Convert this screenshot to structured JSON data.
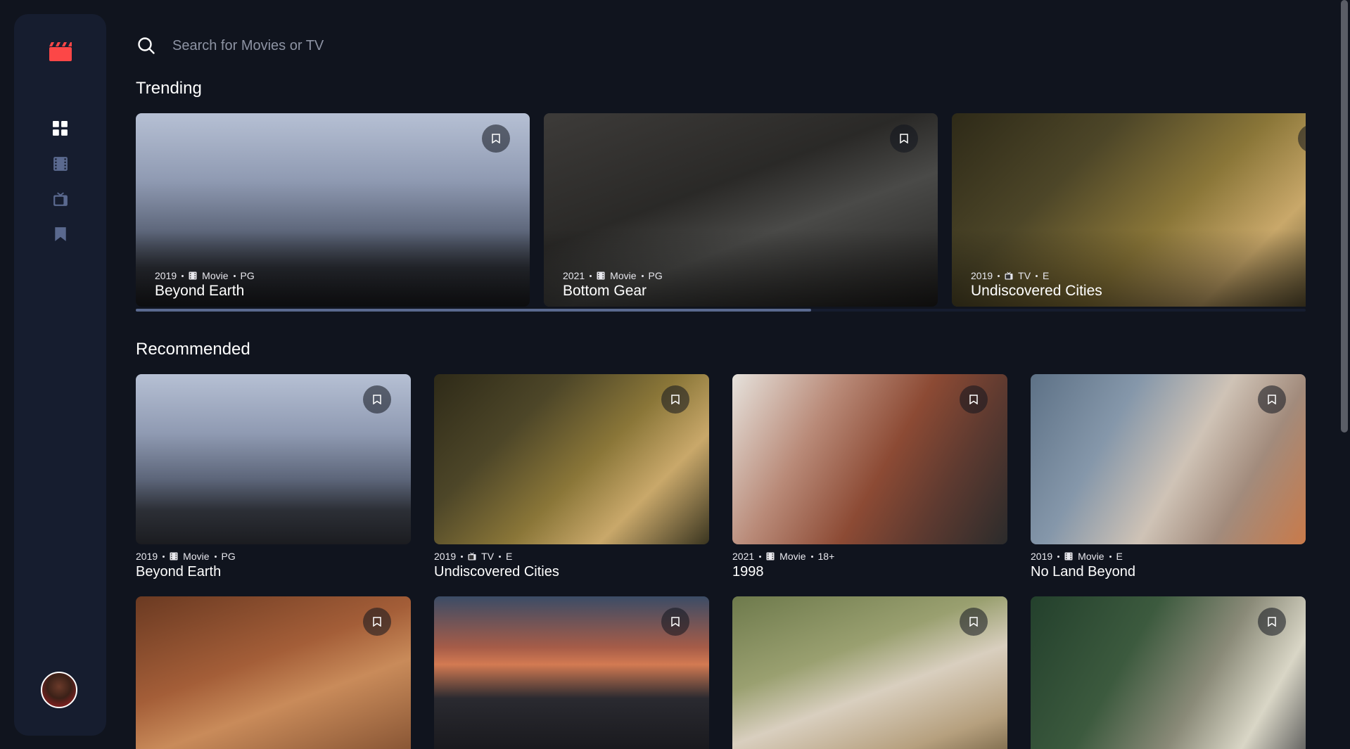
{
  "search": {
    "placeholder": "Search for Movies or TV"
  },
  "sections": {
    "trending_title": "Trending",
    "recommended_title": "Recommended"
  },
  "trending_progress": 0.577,
  "trending": [
    {
      "year": "2019",
      "category": "Movie",
      "rating": "PG",
      "title": "Beyond Earth",
      "image": "rocky-coast"
    },
    {
      "year": "2021",
      "category": "Movie",
      "rating": "PG",
      "title": "Bottom Gear",
      "image": "car-garage"
    },
    {
      "year": "2019",
      "category": "TV",
      "rating": "E",
      "title": "Undiscovered Cities",
      "image": "steering-wheel"
    }
  ],
  "recommended": [
    {
      "year": "2019",
      "category": "Movie",
      "rating": "PG",
      "title": "Beyond Earth",
      "image": "rocky-coast"
    },
    {
      "year": "2019",
      "category": "TV",
      "rating": "E",
      "title": "Undiscovered Cities",
      "image": "steering-wheel"
    },
    {
      "year": "2021",
      "category": "Movie",
      "rating": "18+",
      "title": "1998",
      "image": "woman-hair"
    },
    {
      "year": "2019",
      "category": "Movie",
      "rating": "E",
      "title": "No Land Beyond",
      "image": "young-man"
    },
    {
      "image": "deer"
    },
    {
      "image": "bmw-car"
    },
    {
      "image": "woman-hat"
    },
    {
      "image": "man-truck"
    }
  ],
  "icons": {
    "logo": "film-clapper-icon",
    "nav": [
      "home-grid-icon",
      "movies-film-icon",
      "tv-series-icon",
      "bookmark-icon"
    ]
  },
  "colors": {
    "background": "#10141e",
    "sidebar": "#161d2f",
    "logo": "#fc4747",
    "nav_active": "#ffffff",
    "nav_inactive": "#5a698f"
  }
}
